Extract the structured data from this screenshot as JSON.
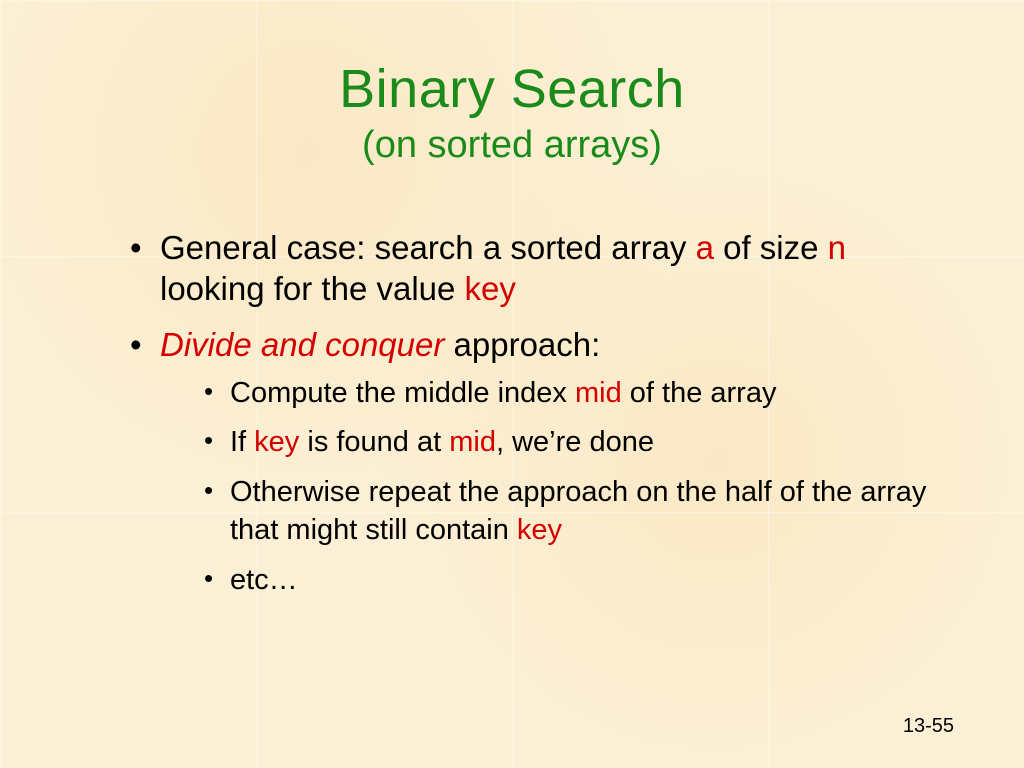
{
  "title": "Binary Search",
  "subtitle": "(on sorted arrays)",
  "bullets": {
    "b1_pre": "General case: search a sorted array ",
    "b1_a": "a",
    "b1_mid": " of size ",
    "b1_n": "n",
    "b1_mid2": " looking for the value ",
    "b1_key": "key",
    "b2_dac": "Divide and conquer",
    "b2_rest": " approach:",
    "s1_pre": "Compute the middle index ",
    "s1_mid": "mid",
    "s1_post": " of the array",
    "s2_pre": "If ",
    "s2_key": "key",
    "s2_mid": " is found at ",
    "s2_midw": "mid",
    "s2_post": ", we’re done",
    "s3_pre": "Otherwise repeat the approach on the half of the array that might still contain ",
    "s3_key": "key",
    "s4": "etc…"
  },
  "pagenum": "13-55"
}
